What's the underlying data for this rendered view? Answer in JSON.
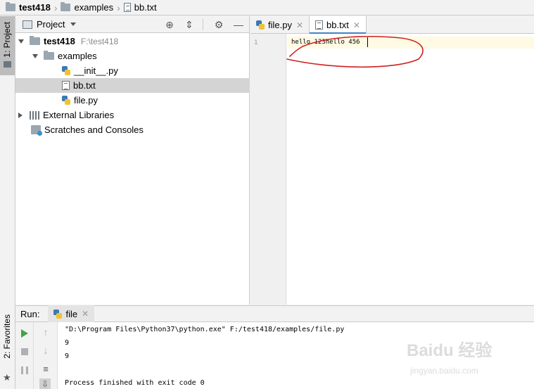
{
  "breadcrumb": {
    "project": "test418",
    "folder": "examples",
    "file": "bb.txt"
  },
  "left_stripe": {
    "project_label": "1: Project",
    "favorites_label": "2: Favorites"
  },
  "project_panel": {
    "title": "Project",
    "tree": {
      "root_name": "test418",
      "root_path": "F:\\test418",
      "examples_folder": "examples",
      "init_file": "__init__.py",
      "bb_file": "bb.txt",
      "file_py": "file.py",
      "external_libraries": "External Libraries",
      "scratches": "Scratches and Consoles"
    }
  },
  "editor": {
    "tabs": [
      {
        "label": "file.py",
        "active": false
      },
      {
        "label": "bb.txt",
        "active": true
      }
    ],
    "line_number": "1",
    "line_text": "hello 123hello 456"
  },
  "run": {
    "title": "Run:",
    "tab_label": "file",
    "console": [
      "\"D:\\Program Files\\Python37\\python.exe\" F:/test418/examples/file.py",
      "9",
      "9",
      "",
      "Process finished with exit code 0"
    ]
  },
  "watermark": {
    "brand": "Baidu 经验",
    "sub": "jingyan.baidu.com"
  },
  "colors": {
    "accent_tab": "#4083c9",
    "annotation": "#d02020",
    "run_green": "#45a34a",
    "selection": "#d4d4d4"
  }
}
